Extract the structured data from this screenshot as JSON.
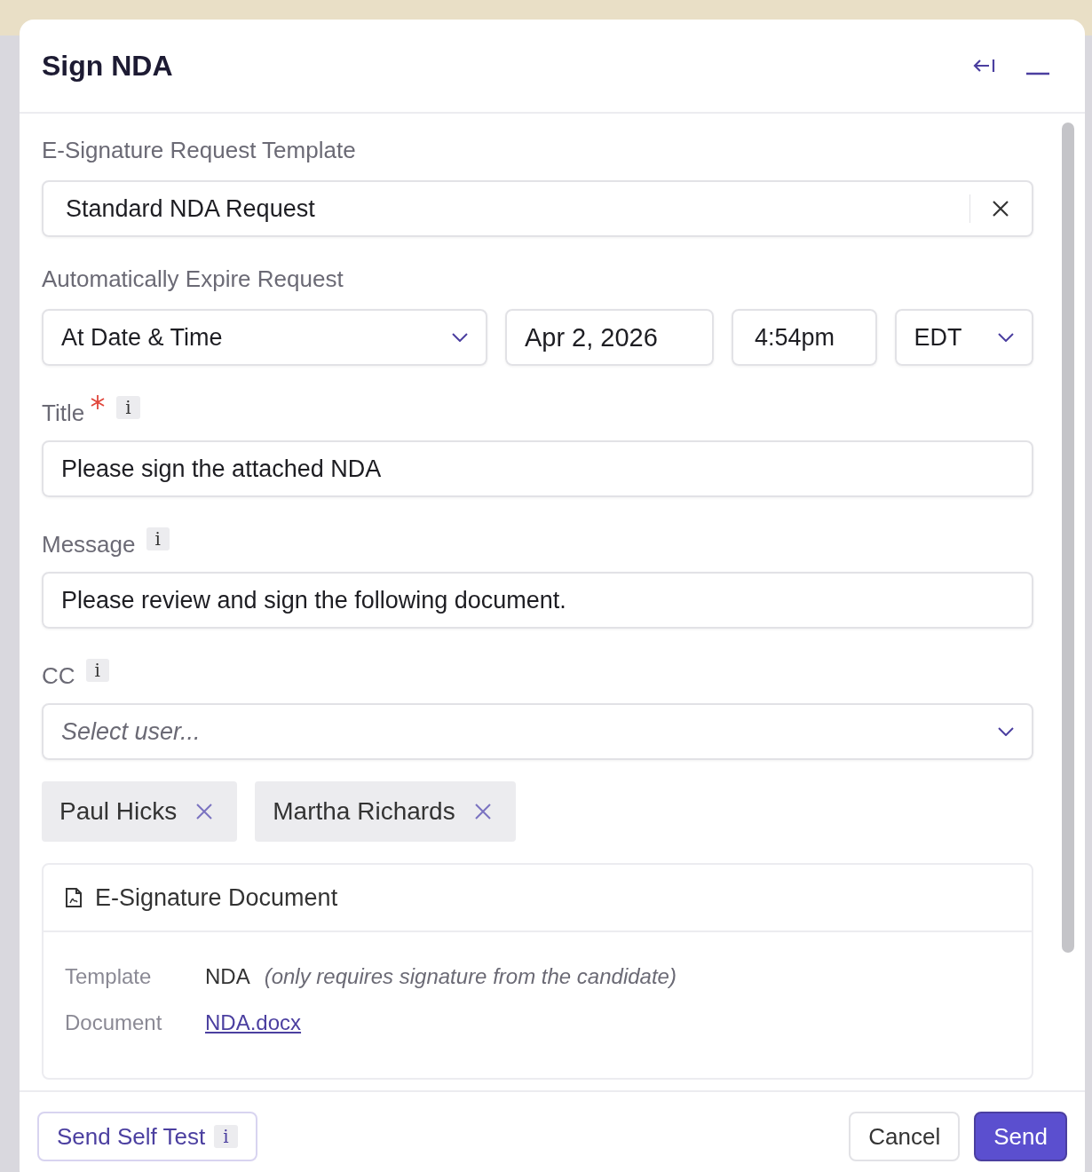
{
  "dialog": {
    "title": "Sign NDA"
  },
  "template": {
    "label": "E-Signature Request Template",
    "value": "Standard NDA Request"
  },
  "expire": {
    "label": "Automatically Expire Request",
    "mode": "At Date & Time",
    "date": "Apr 2, 2026",
    "time": "4:54pm",
    "timezone": "EDT"
  },
  "title_field": {
    "label": "Title",
    "required": true,
    "info": "i",
    "value": "Please sign the attached NDA"
  },
  "message_field": {
    "label": "Message",
    "info": "i",
    "value": "Please review and sign the following document."
  },
  "cc": {
    "label": "CC",
    "info": "i",
    "placeholder": "Select user...",
    "chips": [
      "Paul Hicks",
      "Martha Richards"
    ]
  },
  "document": {
    "title": "E-Signature Document",
    "rows": [
      {
        "label": "Template",
        "kind": "text",
        "value": "NDA",
        "note": "(only requires signature from the candidate)"
      },
      {
        "label": "Document",
        "kind": "link",
        "value": "NDA.docx"
      }
    ]
  },
  "footer": {
    "self_test": "Send Self Test",
    "self_test_info": "i",
    "cancel": "Cancel",
    "send": "Send"
  }
}
